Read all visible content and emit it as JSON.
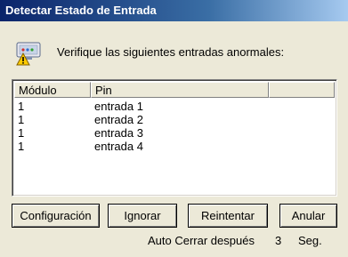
{
  "window": {
    "title": "Detectar Estado de Entrada"
  },
  "message": {
    "icon": "input-warning-icon",
    "text": "Verifique las siguientes entradas anormales:"
  },
  "table": {
    "columns": [
      "Módulo",
      "Pin",
      ""
    ],
    "rows": [
      {
        "modulo": "1",
        "pin": "entrada 1"
      },
      {
        "modulo": "1",
        "pin": "entrada 2"
      },
      {
        "modulo": "1",
        "pin": "entrada 3"
      },
      {
        "modulo": "1",
        "pin": "entrada 4"
      }
    ]
  },
  "buttons": {
    "config": "Configuración",
    "ignore": "Ignorar",
    "retry": "Reintentar",
    "cancel": "Anular"
  },
  "auto_close": {
    "label": "Auto Cerrar después",
    "seconds": "3",
    "unit": "Seg."
  },
  "colors": {
    "titlebar_start": "#0a246a",
    "titlebar_end": "#a6caf0",
    "dialog_bg": "#ece9d8",
    "warning": "#ffcc00"
  }
}
